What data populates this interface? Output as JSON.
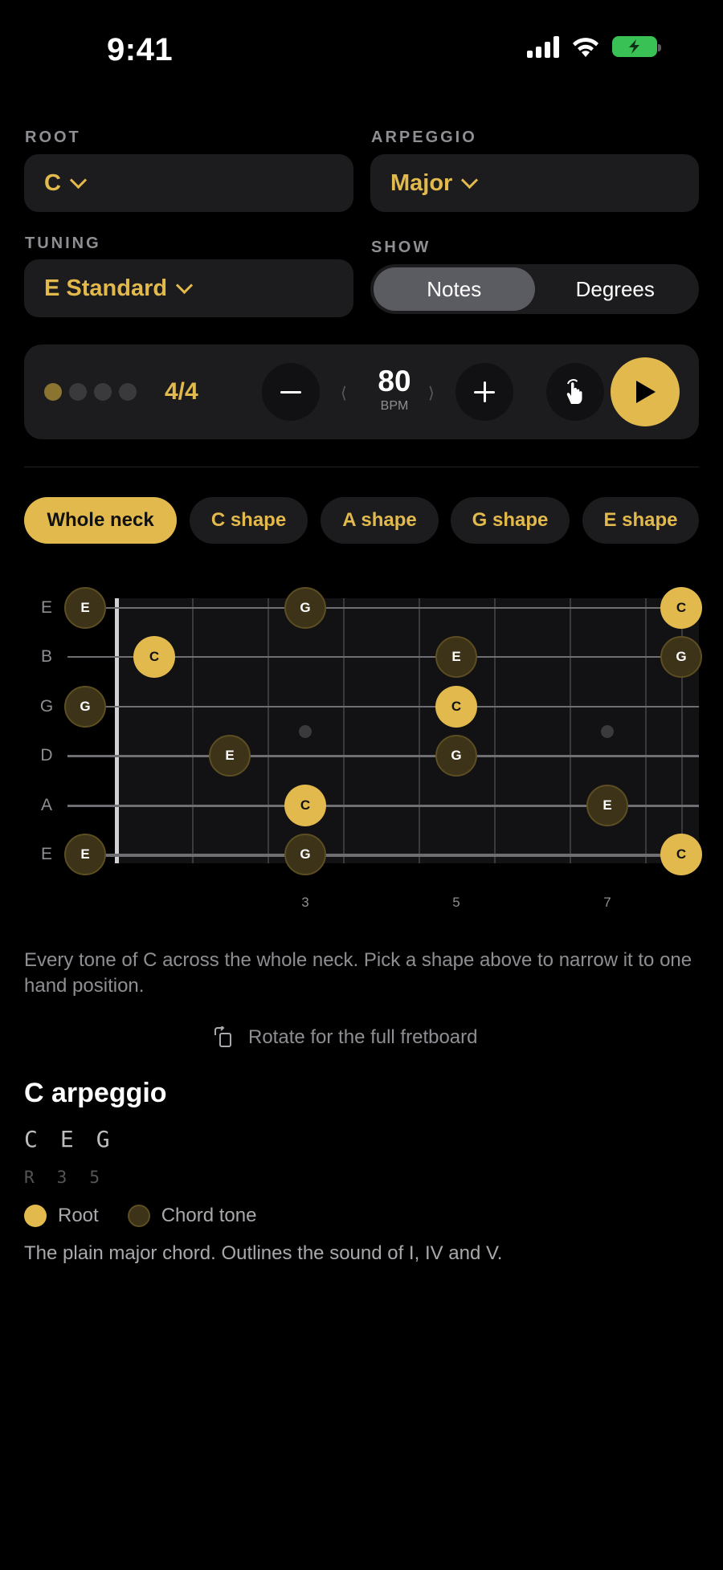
{
  "status": {
    "time": "9:41"
  },
  "root": {
    "label": "ROOT",
    "value": "C"
  },
  "arpeggio": {
    "label": "ARPEGGIO",
    "value": "Major"
  },
  "tuning": {
    "label": "TUNING",
    "value": "E Standard"
  },
  "show": {
    "label": "SHOW",
    "options": [
      "Notes",
      "Degrees"
    ],
    "selected": "Notes"
  },
  "metronome": {
    "time_signature": "4/4",
    "bpm": "80",
    "bpm_unit": "BPM",
    "beats_total": 4,
    "current_beat": 1
  },
  "shapes": [
    {
      "label": "Whole neck",
      "active": true
    },
    {
      "label": "C shape",
      "active": false
    },
    {
      "label": "A shape",
      "active": false
    },
    {
      "label": "G shape",
      "active": false
    },
    {
      "label": "E shape",
      "active": false
    }
  ],
  "fretboard": {
    "strings": [
      "E",
      "B",
      "G",
      "D",
      "A",
      "E"
    ],
    "fret_markers": [
      "3",
      "5",
      "7"
    ],
    "notes": [
      {
        "string": 0,
        "fret": 0,
        "note": "E",
        "root": false
      },
      {
        "string": 0,
        "fret": 3,
        "note": "G",
        "root": false
      },
      {
        "string": 0,
        "fret": 8,
        "note": "C",
        "root": true
      },
      {
        "string": 1,
        "fret": 1,
        "note": "C",
        "root": true
      },
      {
        "string": 1,
        "fret": 5,
        "note": "E",
        "root": false
      },
      {
        "string": 1,
        "fret": 8,
        "note": "G",
        "root": false
      },
      {
        "string": 2,
        "fret": 0,
        "note": "G",
        "root": false
      },
      {
        "string": 2,
        "fret": 5,
        "note": "C",
        "root": true
      },
      {
        "string": 3,
        "fret": 2,
        "note": "E",
        "root": false
      },
      {
        "string": 3,
        "fret": 5,
        "note": "G",
        "root": false
      },
      {
        "string": 4,
        "fret": 3,
        "note": "C",
        "root": true
      },
      {
        "string": 4,
        "fret": 7,
        "note": "E",
        "root": false
      },
      {
        "string": 5,
        "fret": 0,
        "note": "E",
        "root": false
      },
      {
        "string": 5,
        "fret": 3,
        "note": "G",
        "root": false
      },
      {
        "string": 5,
        "fret": 8,
        "note": "C",
        "root": true
      }
    ]
  },
  "description": "Every tone of C across the whole neck. Pick a shape above to narrow it to one hand position.",
  "rotate_hint": "Rotate for the full fretboard",
  "arpeggio_info": {
    "title": "C arpeggio",
    "notes": [
      "C",
      "E",
      "G"
    ],
    "degrees": [
      "R",
      "3",
      "5"
    ],
    "legend_root": "Root",
    "legend_tone": "Chord tone",
    "summary": "The plain major chord. Outlines the sound of I, IV and V."
  },
  "colors": {
    "accent": "#e2b94d",
    "chord_tone": "#3d3318",
    "background": "#000000",
    "surface": "#1c1c1e"
  }
}
